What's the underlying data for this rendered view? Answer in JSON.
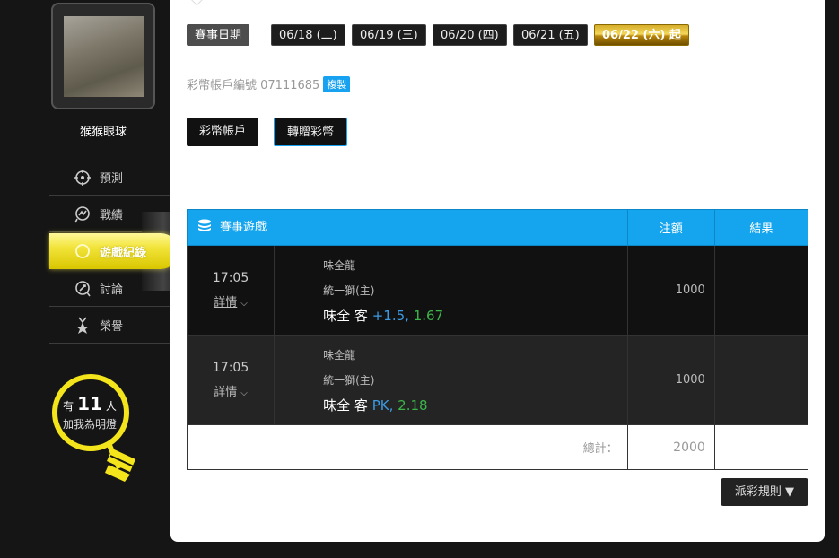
{
  "sidebar": {
    "username": "猴猴眼球",
    "nav": [
      {
        "label": "預測",
        "icon": "crosshair-icon"
      },
      {
        "label": "戰績",
        "icon": "chart-icon"
      },
      {
        "label": "遊戲紀錄",
        "icon": "record-icon",
        "active": true
      },
      {
        "label": "討論",
        "icon": "discussion-icon"
      },
      {
        "label": "榮譽",
        "icon": "medal-icon"
      }
    ],
    "bulb": {
      "prefix": "有",
      "count": "11",
      "suffix": "人",
      "line2": "加我為明燈",
      "color": "#f3e41b"
    }
  },
  "dates": {
    "label": "賽事日期",
    "items": [
      "06/18 (二)",
      "06/19 (三)",
      "06/20 (四)",
      "06/21 (五)",
      "06/22 (六) 起"
    ]
  },
  "account": {
    "label": "彩幣帳戶編號 07111685",
    "copy": "複製"
  },
  "actions": {
    "wallet": "彩幣帳戶",
    "transfer": "轉贈彩幣"
  },
  "table": {
    "headers": {
      "game": "賽事遊戲",
      "amount": "注額",
      "result": "結果"
    },
    "rows": [
      {
        "time": "17:05",
        "details": "詳情",
        "away": "味全龍",
        "home": "統一獅(主)",
        "pick_team": "味全",
        "pick_side": "客",
        "handicap": "+1.5,",
        "odds": "1.67",
        "amount": "1000",
        "result": ""
      },
      {
        "time": "17:05",
        "details": "詳情",
        "away": "味全龍",
        "home": "統一獅(主)",
        "pick_team": "味全",
        "pick_side": "客",
        "handicap": "PK,",
        "odds": "2.18",
        "amount": "1000",
        "result": ""
      }
    ],
    "total_label": "總計：",
    "total_value": "2000"
  },
  "rules_button": "派彩規則 ▼",
  "colors": {
    "accent": "#15a5ee",
    "gold": "#d6ae2b",
    "bulb": "#f3e41b",
    "odds_green": "#3bb44a",
    "handicap_blue": "#3d9be3"
  }
}
